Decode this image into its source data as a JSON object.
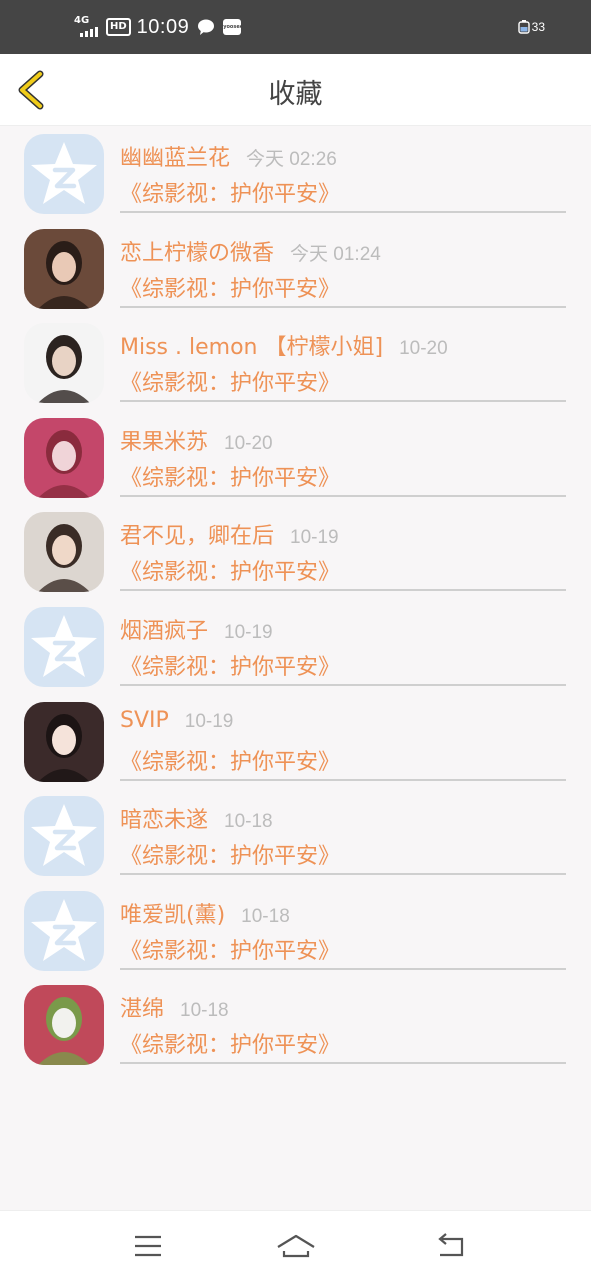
{
  "status_bar": {
    "network": "4G",
    "hd": "HD",
    "time": "10:09",
    "app_icon_text": "yoosee",
    "battery": "33"
  },
  "header": {
    "title": "收藏",
    "back_icon": "chevron-left-icon"
  },
  "items": [
    {
      "name": "幽幽蓝兰花",
      "date": "今天 02:26",
      "desc": "《综影视：护你平安》",
      "avatar": "default-star"
    },
    {
      "name": "恋上柠檬の微香",
      "date": "今天 01:24",
      "desc": "《综影视：护你平安》",
      "avatar": "photo"
    },
    {
      "name": "Miss . lemon 【柠檬小姐]",
      "date": "10-20",
      "desc": "《综影视：护你平安》",
      "avatar": "photo"
    },
    {
      "name": "果果米苏",
      "date": "10-20",
      "desc": "《综影视：护你平安》",
      "avatar": "photo"
    },
    {
      "name": "君不见，卿在后",
      "date": "10-19",
      "desc": "《综影视：护你平安》",
      "avatar": "photo"
    },
    {
      "name": "烟酒疯子",
      "date": "10-19",
      "desc": "《综影视：护你平安》",
      "avatar": "default-star"
    },
    {
      "name": "SVIP",
      "date": "10-19",
      "desc": "《综影视：护你平安》",
      "avatar": "photo"
    },
    {
      "name": "暗恋未遂",
      "date": "10-18",
      "desc": "《综影视：护你平安》",
      "avatar": "default-star"
    },
    {
      "name": "唯爱凯(薰)",
      "date": "10-18",
      "desc": "《综影视：护你平安》",
      "avatar": "default-star"
    },
    {
      "name": "湛绵",
      "date": "10-18",
      "desc": "《综影视：护你平安》",
      "avatar": "photo"
    }
  ],
  "nav": {
    "menu_icon": "menu-icon",
    "home_icon": "home-icon",
    "back_icon": "back-arrow-icon"
  },
  "colors": {
    "accent": "#ee9256",
    "back_chevron": "#e8c200",
    "date_gray": "#bcbcbc",
    "status_bar": "#454545"
  }
}
